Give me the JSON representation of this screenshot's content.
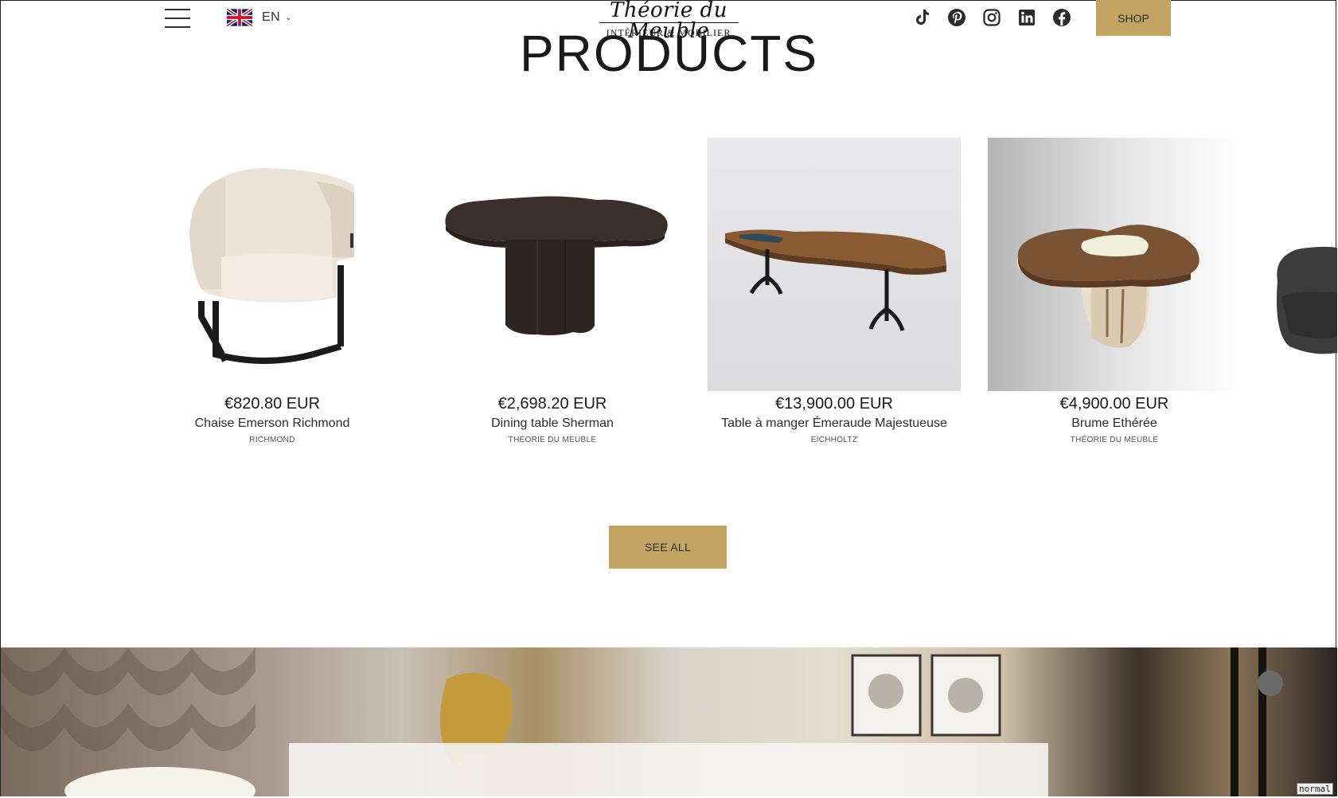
{
  "header": {
    "menu_icon": "hamburger-menu-icon",
    "language": {
      "code": "EN",
      "flag": "uk-flag-icon"
    },
    "logo": {
      "script": "Théorie du Meuble",
      "subtitle": "INTÉRIEUR & MOBILIER"
    },
    "socials": [
      "tiktok-icon",
      "pinterest-icon",
      "instagram-icon",
      "linkedin-icon",
      "facebook-icon"
    ],
    "shop_label": "SHOP"
  },
  "section": {
    "title": "PRODUCTS"
  },
  "products": [
    {
      "price": "€820.80 EUR",
      "name": "Chaise Emerson Richmond",
      "brand": "RICHMOND"
    },
    {
      "price": "€2,698.20 EUR",
      "name": "Dining table Sherman",
      "brand": "THÉORIE DU MEUBLE"
    },
    {
      "price": "€13,900.00 EUR",
      "name": "Table à manger Émeraude Majestueuse",
      "brand": "EICHHOLTZ"
    },
    {
      "price": "€4,900.00 EUR",
      "name": "Brume Ethérée",
      "brand": "THÉORIE DU MEUBLE"
    }
  ],
  "see_all_label": "SEE ALL",
  "status_tag": "normal",
  "colors": {
    "accent": "#c4a462",
    "text": "#1a1a1a",
    "background": "#ffffff"
  }
}
